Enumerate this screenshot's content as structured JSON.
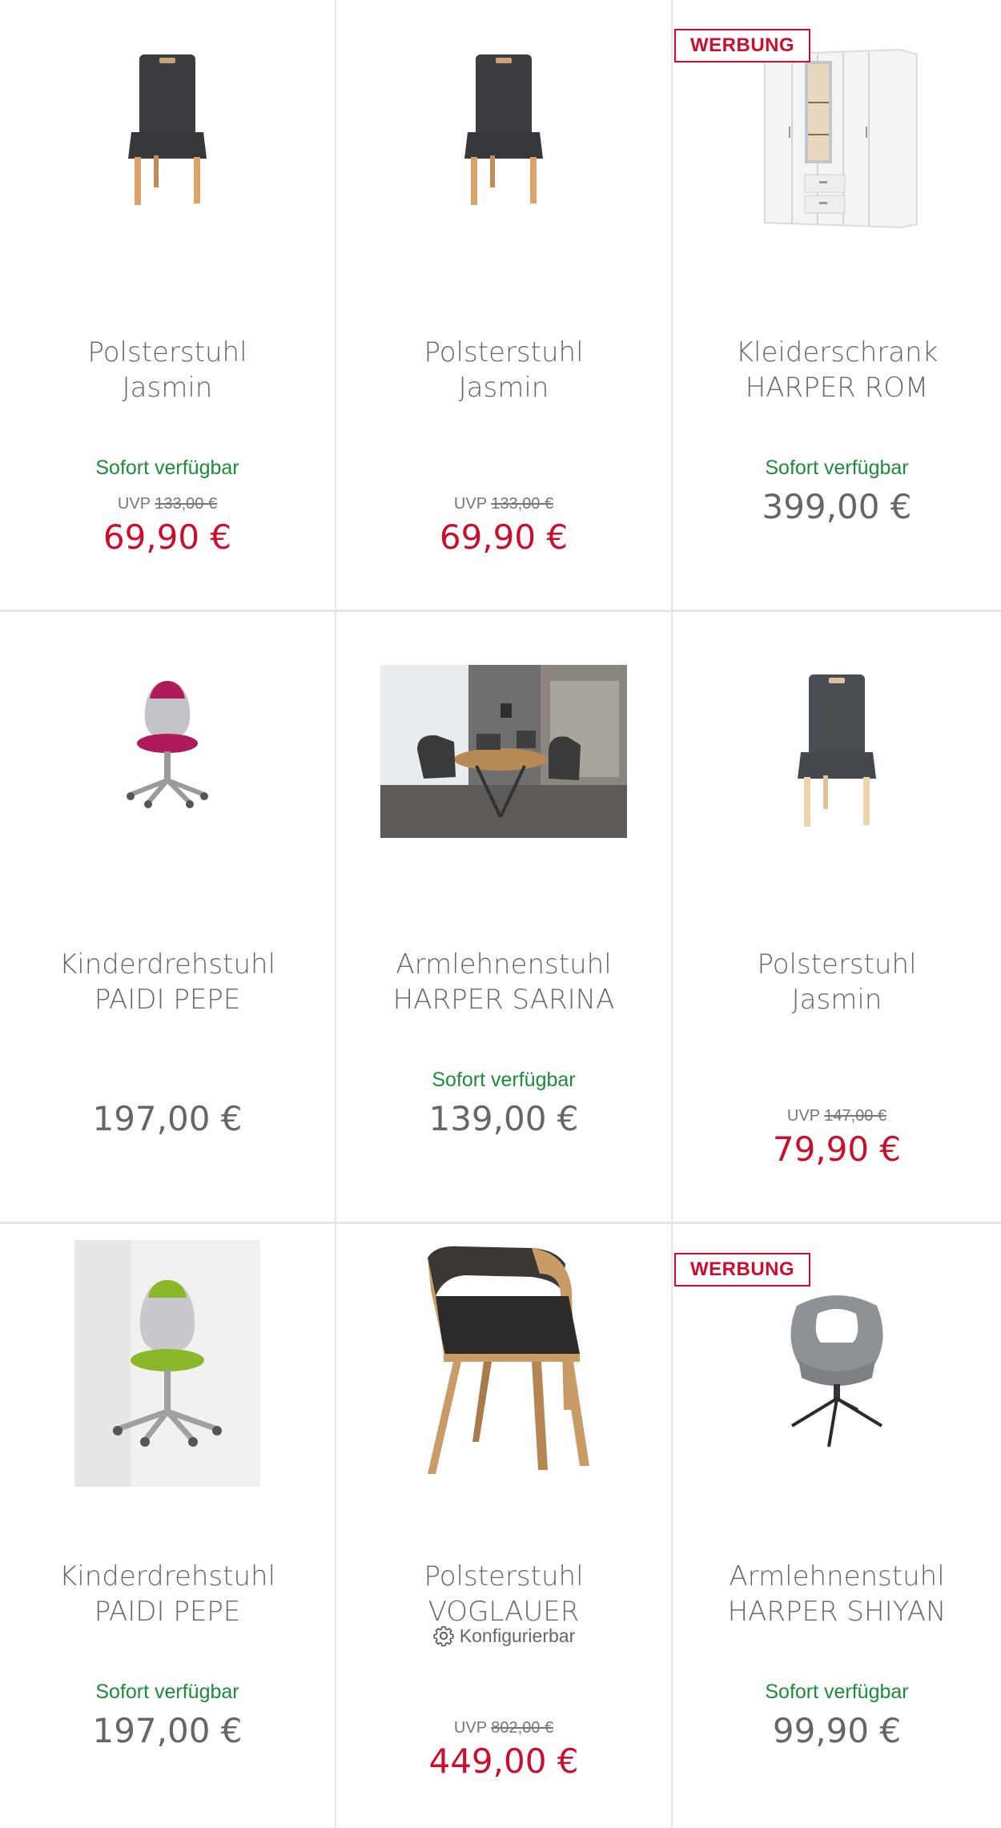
{
  "colors": {
    "accent_red": "#c8102e",
    "available_green": "#1e8a3c",
    "text_gray": "#666666",
    "divider": "#e6e6e6"
  },
  "products": [
    {
      "title_line1": "Polsterstuhl",
      "title_line2": "Jasmin",
      "availability": "Sofort verfügbar",
      "uvp_label": "UVP",
      "uvp_price": "133,00 €",
      "price": "69,90 €",
      "image": "dark-upholstered-chair"
    },
    {
      "title_line1": "Polsterstuhl",
      "title_line2": "Jasmin",
      "uvp_label": "UVP",
      "uvp_price": "133,00 €",
      "price": "69,90 €",
      "image": "dark-upholstered-chair"
    },
    {
      "badge": "WERBUNG",
      "title_line1": "Kleiderschrank",
      "title_line2": "HARPER ROM",
      "availability": "Sofort verfügbar",
      "price": "399,00 €",
      "image": "white-wardrobe"
    },
    {
      "title_line1": "Kinderdrehstuhl",
      "title_line2": "PAIDI PEPE",
      "price": "197,00 €",
      "image": "pink-kids-swivel-chair"
    },
    {
      "title_line1": "Armlehnenstuhl",
      "title_line2": "HARPER SARINA",
      "availability": "Sofort verfügbar",
      "price": "139,00 €",
      "image": "dining-room-scene"
    },
    {
      "title_line1": "Polsterstuhl",
      "title_line2": "Jasmin",
      "uvp_label": "UVP",
      "uvp_price": "147,00 €",
      "price": "79,90 €",
      "image": "gray-upholstered-chair"
    },
    {
      "title_line1": "Kinderdrehstuhl",
      "title_line2": "PAIDI PEPE",
      "availability": "Sofort verfügbar",
      "price": "197,00 €",
      "image": "green-kids-swivel-chair"
    },
    {
      "title_line1": "Polsterstuhl",
      "title_line2": "VOGLAUER",
      "config": "Konfigurierbar",
      "uvp_label": "UVP",
      "uvp_price": "802,00 €",
      "price": "449,00 €",
      "image": "wooden-leather-chair"
    },
    {
      "badge": "WERBUNG",
      "title_line1": "Armlehnenstuhl",
      "title_line2": "HARPER SHIYAN",
      "availability": "Sofort verfügbar",
      "price": "99,90 €",
      "image": "gray-shell-chair"
    }
  ]
}
